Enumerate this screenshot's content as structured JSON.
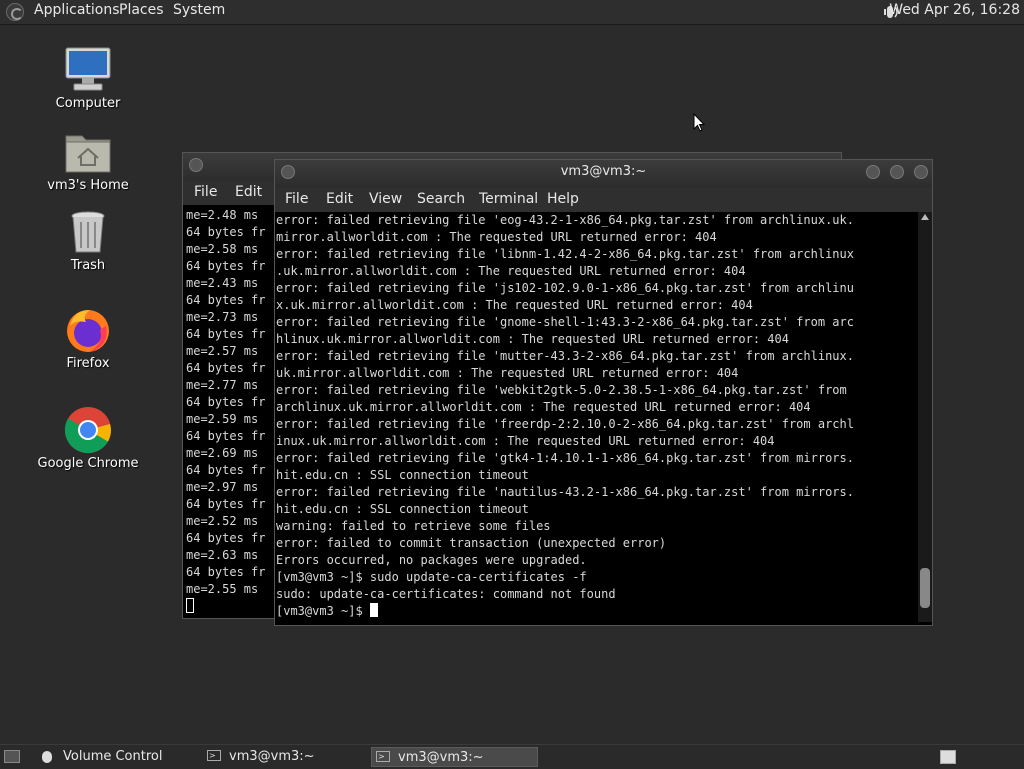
{
  "top_panel": {
    "menus": [
      "Applications",
      "Places",
      "System"
    ],
    "clock": "Wed Apr 26, 16:28"
  },
  "desktop_icons": [
    {
      "label": "Computer",
      "icon": "computer-icon"
    },
    {
      "label": "vm3's Home",
      "icon": "home-folder-icon"
    },
    {
      "label": "Trash",
      "icon": "trash-icon"
    },
    {
      "label": "Firefox",
      "icon": "firefox-icon"
    },
    {
      "label": "Google Chrome",
      "icon": "chrome-icon"
    }
  ],
  "back_window": {
    "menus": [
      "File",
      "Edit"
    ],
    "lines": [
      "me=2.48 ms",
      "64 bytes fr",
      "me=2.58 ms",
      "64 bytes fr",
      "me=2.43 ms",
      "64 bytes fr",
      "me=2.73 ms",
      "64 bytes fr",
      "me=2.57 ms",
      "64 bytes fr",
      "me=2.77 ms",
      "64 bytes fr",
      "me=2.59 ms",
      "64 bytes fr",
      "me=2.69 ms",
      "64 bytes fr",
      "me=2.97 ms",
      "64 bytes fr",
      "me=2.52 ms",
      "64 bytes fr",
      "me=2.63 ms",
      "64 bytes fr",
      "me=2.55 ms"
    ]
  },
  "front_window": {
    "title": "vm3@vm3:~",
    "menus": [
      "File",
      "Edit",
      "View",
      "Search",
      "Terminal",
      "Help"
    ],
    "lines": [
      "error: failed retrieving file 'eog-43.2-1-x86_64.pkg.tar.zst' from archlinux.uk.",
      "mirror.allworldit.com : The requested URL returned error: 404",
      "error: failed retrieving file 'libnm-1.42.4-2-x86_64.pkg.tar.zst' from archlinux",
      ".uk.mirror.allworldit.com : The requested URL returned error: 404",
      "error: failed retrieving file 'js102-102.9.0-1-x86_64.pkg.tar.zst' from archlinu",
      "x.uk.mirror.allworldit.com : The requested URL returned error: 404",
      "error: failed retrieving file 'gnome-shell-1:43.3-2-x86_64.pkg.tar.zst' from arc",
      "hlinux.uk.mirror.allworldit.com : The requested URL returned error: 404",
      "error: failed retrieving file 'mutter-43.3-2-x86_64.pkg.tar.zst' from archlinux.",
      "uk.mirror.allworldit.com : The requested URL returned error: 404",
      "error: failed retrieving file 'webkit2gtk-5.0-2.38.5-1-x86_64.pkg.tar.zst' from",
      "archlinux.uk.mirror.allworldit.com : The requested URL returned error: 404",
      "error: failed retrieving file 'freerdp-2:2.10.0-2-x86_64.pkg.tar.zst' from archl",
      "inux.uk.mirror.allworldit.com : The requested URL returned error: 404",
      "error: failed retrieving file 'gtk4-1:4.10.1-1-x86_64.pkg.tar.zst' from mirrors.",
      "hit.edu.cn : SSL connection timeout",
      "error: failed retrieving file 'nautilus-43.2-1-x86_64.pkg.tar.zst' from mirrors.",
      "hit.edu.cn : SSL connection timeout",
      "warning: failed to retrieve some files",
      "error: failed to commit transaction (unexpected error)",
      "Errors occurred, no packages were upgraded.",
      "[vm3@vm3 ~]$ sudo update-ca-certificates -f",
      "sudo: update-ca-certificates: command not found",
      "[vm3@vm3 ~]$ "
    ]
  },
  "bottom_panel": {
    "tasks": [
      {
        "label": "Volume Control",
        "active": false
      },
      {
        "label": "vm3@vm3:~",
        "active": false
      },
      {
        "label": "vm3@vm3:~",
        "active": true
      }
    ]
  }
}
